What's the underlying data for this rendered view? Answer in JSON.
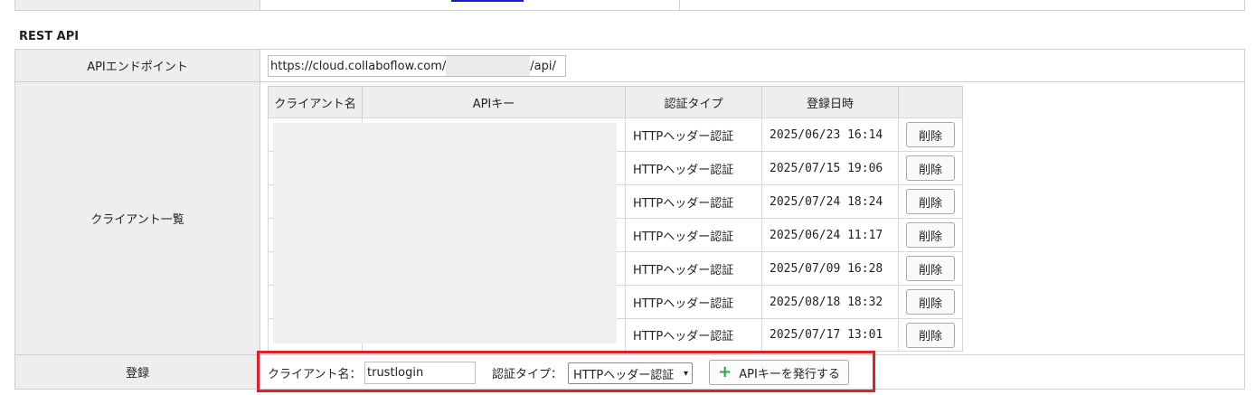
{
  "section": {
    "title": "REST API"
  },
  "api_endpoint": {
    "label": "APIエンドポイント",
    "value_prefix": "https://cloud.collaboflow.com/",
    "value_suffix": "/api/"
  },
  "clients": {
    "label": "クライアント一覧",
    "columns": [
      "クライアント名",
      "APIキー",
      "認証タイプ",
      "登録日時",
      ""
    ],
    "rows": [
      {
        "auth": "HTTPヘッダー認証",
        "date": "2025/06/23 16:14",
        "action": "削除"
      },
      {
        "auth": "HTTPヘッダー認証",
        "date": "2025/07/15 19:06",
        "action": "削除"
      },
      {
        "auth": "HTTPヘッダー認証",
        "date": "2025/07/24 18:24",
        "action": "削除"
      },
      {
        "auth": "HTTPヘッダー認証",
        "date": "2025/06/24 11:17",
        "action": "削除"
      },
      {
        "auth": "HTTPヘッダー認証",
        "date": "2025/07/09 16:28",
        "action": "削除"
      },
      {
        "auth": "HTTPヘッダー認証",
        "date": "2025/08/18 18:32",
        "action": "削除"
      },
      {
        "auth": "HTTPヘッダー認証",
        "date": "2025/07/17 13:01",
        "action": "削除"
      }
    ]
  },
  "register": {
    "label": "登録",
    "client_name_label": "クライアント名：",
    "client_name_value": "trustlogin",
    "auth_type_label": "認証タイプ：",
    "auth_type_value": "HTTPヘッダー認証",
    "submit_label": "APIキーを発行する",
    "submit_icon": "plus-icon"
  },
  "colors": {
    "highlight": "#e0202a",
    "plus": "#2fa35a",
    "header_bg": "#eeeeee"
  }
}
